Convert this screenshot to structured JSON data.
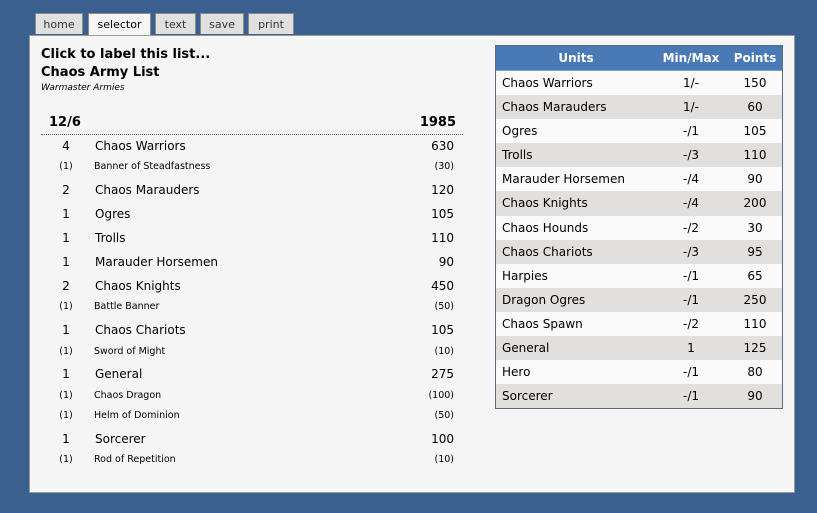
{
  "tabs": [
    {
      "label": "home",
      "active": false
    },
    {
      "label": "selector",
      "active": true
    },
    {
      "label": "text",
      "active": false
    },
    {
      "label": "save",
      "active": false
    },
    {
      "label": "print",
      "active": false
    }
  ],
  "army": {
    "label_prompt": "Click to label this list...",
    "name": "Chaos Army List",
    "subtitle": "Warmaster Armies",
    "summary_left": "12/6",
    "summary_right": "1985"
  },
  "entries": [
    {
      "type": "unit",
      "qty": "4",
      "name": "Chaos Warriors",
      "points": "630"
    },
    {
      "type": "item",
      "qty": "(1)",
      "name": "Banner of Steadfastness",
      "points": "(30)"
    },
    {
      "type": "unit",
      "qty": "2",
      "name": "Chaos Marauders",
      "points": "120"
    },
    {
      "type": "unit",
      "qty": "1",
      "name": "Ogres",
      "points": "105"
    },
    {
      "type": "unit",
      "qty": "1",
      "name": "Trolls",
      "points": "110"
    },
    {
      "type": "unit",
      "qty": "1",
      "name": "Marauder Horsemen",
      "points": "90"
    },
    {
      "type": "unit",
      "qty": "2",
      "name": "Chaos Knights",
      "points": "450"
    },
    {
      "type": "item",
      "qty": "(1)",
      "name": "Battle Banner",
      "points": "(50)"
    },
    {
      "type": "unit",
      "qty": "1",
      "name": "Chaos Chariots",
      "points": "105"
    },
    {
      "type": "item",
      "qty": "(1)",
      "name": "Sword of Might",
      "points": "(10)"
    },
    {
      "type": "unit",
      "qty": "1",
      "name": "General",
      "points": "275"
    },
    {
      "type": "item",
      "qty": "(1)",
      "name": "Chaos Dragon",
      "points": "(100)"
    },
    {
      "type": "item",
      "qty": "(1)",
      "name": "Helm of Dominion",
      "points": "(50)"
    },
    {
      "type": "unit",
      "qty": "1",
      "name": "Sorcerer",
      "points": "100"
    },
    {
      "type": "item",
      "qty": "(1)",
      "name": "Rod of Repetition",
      "points": "(10)"
    }
  ],
  "units_table": {
    "headers": {
      "units": "Units",
      "minmax": "Min/Max",
      "points": "Points"
    },
    "rows": [
      {
        "name": "Chaos Warriors",
        "minmax": "1/-",
        "points": "150"
      },
      {
        "name": "Chaos Marauders",
        "minmax": "1/-",
        "points": "60"
      },
      {
        "name": "Ogres",
        "minmax": "-/1",
        "points": "105"
      },
      {
        "name": "Trolls",
        "minmax": "-/3",
        "points": "110"
      },
      {
        "name": "Marauder Horsemen",
        "minmax": "-/4",
        "points": "90"
      },
      {
        "name": "Chaos Knights",
        "minmax": "-/4",
        "points": "200"
      },
      {
        "name": "Chaos Hounds",
        "minmax": "-/2",
        "points": "30"
      },
      {
        "name": "Chaos Chariots",
        "minmax": "-/3",
        "points": "95"
      },
      {
        "name": "Harpies",
        "minmax": "-/1",
        "points": "65"
      },
      {
        "name": "Dragon Ogres",
        "minmax": "-/1",
        "points": "250"
      },
      {
        "name": "Chaos Spawn",
        "minmax": "-/2",
        "points": "110"
      },
      {
        "name": "General",
        "minmax": "1",
        "points": "125"
      },
      {
        "name": "Hero",
        "minmax": "-/1",
        "points": "80"
      },
      {
        "name": "Sorcerer",
        "minmax": "-/1",
        "points": "90"
      }
    ]
  },
  "colors": {
    "background": "#3a6090",
    "table_header": "#4a7ab5",
    "row_alt": "#e2e0de"
  }
}
